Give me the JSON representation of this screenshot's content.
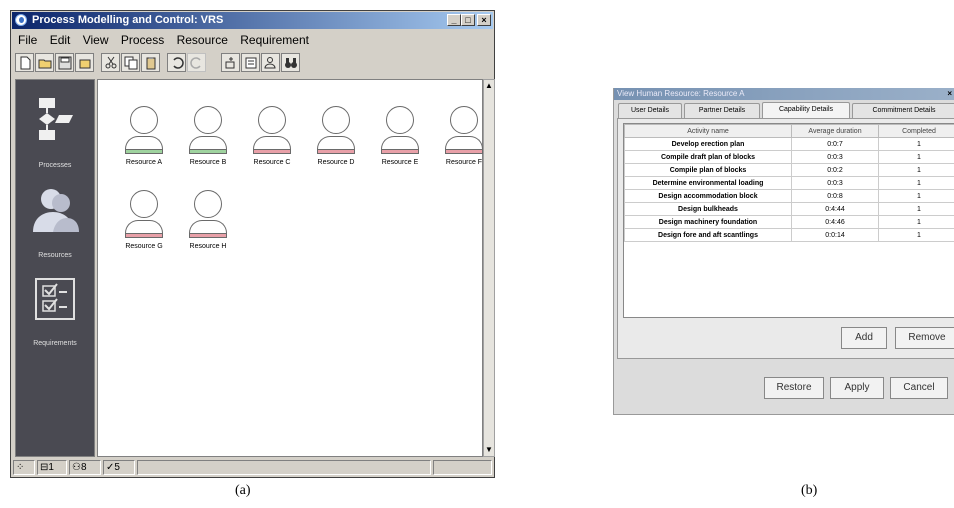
{
  "window_a": {
    "title": "Process Modelling and Control: VRS",
    "menu": [
      "File",
      "Edit",
      "View",
      "Process",
      "Resource",
      "Requirement"
    ],
    "nav": {
      "processes": "Processes",
      "resources": "Resources",
      "requirements": "Requirements"
    },
    "resources": [
      {
        "name": "Resource A",
        "bar_color": "#9fd39f"
      },
      {
        "name": "Resource B",
        "bar_color": "#9fd39f"
      },
      {
        "name": "Resource C",
        "bar_color": "#e8a0a8"
      },
      {
        "name": "Resource D",
        "bar_color": "#e8a0a8"
      },
      {
        "name": "Resource E",
        "bar_color": "#e8a0a8"
      },
      {
        "name": "Resource F",
        "bar_color": "#e8a0a8"
      },
      {
        "name": "Resource G",
        "bar_color": "#e8a0a8"
      },
      {
        "name": "Resource H",
        "bar_color": "#e8a0a8"
      }
    ],
    "status": {
      "processes_count": "1",
      "resources_count": "8",
      "requirements_count": "5"
    },
    "caption": "(a)"
  },
  "window_b": {
    "title": "View Human Resource: Resource A",
    "tabs": [
      "User Details",
      "Partner Details",
      "Capability Details",
      "Commitment Details"
    ],
    "active_tab": "Capability Details",
    "columns": [
      "Activity name",
      "Average duration",
      "Completed"
    ],
    "rows": [
      [
        "Develop erection plan",
        "0:0:7",
        "1"
      ],
      [
        "Compile draft plan of blocks",
        "0:0:3",
        "1"
      ],
      [
        "Compile plan of blocks",
        "0:0:2",
        "1"
      ],
      [
        "Determine environmental loading",
        "0:0:3",
        "1"
      ],
      [
        "Design accommodation block",
        "0:0:8",
        "1"
      ],
      [
        "Design bulkheads",
        "0:4:44",
        "1"
      ],
      [
        "Design machinery foundation",
        "0:4:46",
        "1"
      ],
      [
        "Design fore and aft scantlings",
        "0:0:14",
        "1"
      ]
    ],
    "buttons": {
      "add": "Add",
      "remove": "Remove",
      "restore": "Restore",
      "apply": "Apply",
      "cancel": "Cancel"
    },
    "caption": "(b)"
  },
  "colors": {
    "title_bar": "#0a246a",
    "nav_pane": "#4a4a52",
    "window_bg": "#d4d0c8"
  }
}
